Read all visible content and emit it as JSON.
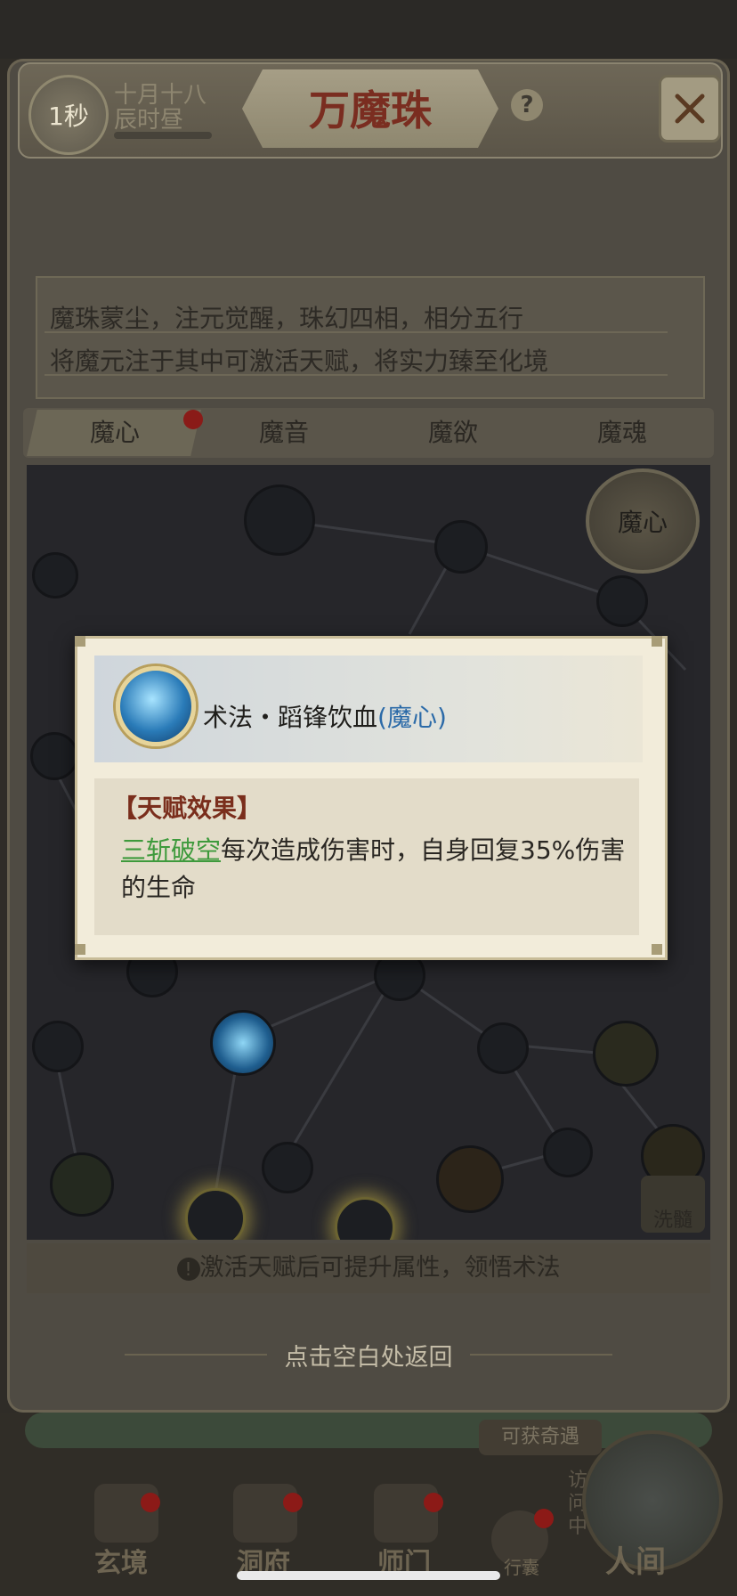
{
  "header": {
    "timer": "1秒",
    "date_line1": "十月十八",
    "date_line2": "辰时昼",
    "title": "万魔珠",
    "help_label": "?"
  },
  "description": {
    "line1": "魔珠蒙尘，注元觉醒，珠幻四相，相分五行",
    "line2": "将魔元注于其中可激活天赋，将实力臻至化境"
  },
  "tabs": [
    "魔心",
    "魔音",
    "魔欲",
    "魔魂"
  ],
  "tree": {
    "badge": "魔心",
    "wash_label": "洗髓",
    "tip": "激活天赋后可提升属性，领悟术法"
  },
  "return_hint": "点击空白处返回",
  "popup": {
    "skill_name": "术法・蹈锋饮血",
    "skill_school": "(魔心)",
    "effect_title": "【天赋效果】",
    "effect_link": "三斩破空",
    "effect_text": "每次造成伤害时，自身回复35%伤害的生命"
  },
  "nav": {
    "encounter": "可获奇遇",
    "visit": "访问中",
    "items": [
      "玄境",
      "洞府",
      "师门",
      "行囊",
      "人间"
    ]
  }
}
